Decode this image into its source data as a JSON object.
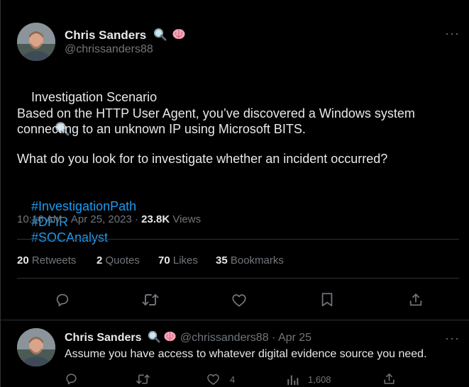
{
  "main_tweet": {
    "author_name": "Chris Sanders",
    "author_handle": "@chrissanders88",
    "name_emojis": [
      "magnifier-icon",
      "brain-icon"
    ],
    "title_line": "Investigation Scenario",
    "paragraph_1": "Based on the HTTP User Agent, you’ve discovered a Windows system\nconnecting to an unknown IP using Microsoft BITS.",
    "paragraph_2": "What do you look for to investigate whether an incident occurred?",
    "hashtags": [
      "#InvestigationPath",
      "#DFIR",
      "#SOCAnalyst"
    ],
    "time": "10:16 AM",
    "date": "Apr 25, 2023",
    "views_count": "23.8K",
    "views_label": "Views",
    "separator": "·"
  },
  "stats": {
    "retweets": {
      "count": "20",
      "label": "Retweets"
    },
    "quotes": {
      "count": "2",
      "label": "Quotes"
    },
    "likes": {
      "count": "70",
      "label": "Likes"
    },
    "bookmarks": {
      "count": "35",
      "label": "Bookmarks"
    }
  },
  "actions": [
    "reply-icon",
    "retweet-icon",
    "like-icon",
    "bookmark-icon",
    "share-icon"
  ],
  "reply": {
    "author_name": "Chris Sanders",
    "author_handle": "@chrissanders88",
    "date": "Apr 25",
    "separator": "·",
    "text": "Assume you have access to whatever digital evidence source you need.",
    "like_count": "4",
    "view_count": "1,608"
  },
  "more_label": "···",
  "colors": {
    "background": "#000000",
    "text": "#e7e9ea",
    "muted": "#71767b",
    "link": "#1d9bf0",
    "divider": "#2f3336"
  }
}
